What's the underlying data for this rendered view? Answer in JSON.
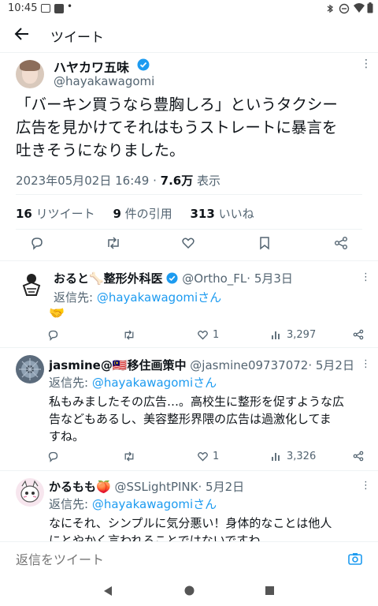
{
  "status_bar": {
    "time": "10:45",
    "dot": "•"
  },
  "header": {
    "title": "ツイート"
  },
  "tweet": {
    "display_name": "ハヤカワ五味",
    "handle": "@hayakawagomi",
    "body_line1": "「バーキン買うなら豊胸しろ」というタクシー",
    "body_line2": "広告を見かけてそれはもうストレートに暴言を",
    "body_line3": "吐きそうになりました。",
    "timestamp": "2023年05月02日 16:49",
    "separator": " · ",
    "views": "7.6万",
    "views_label": "表示",
    "retweets_count": "16",
    "retweets_label": "リツイート",
    "quotes_count": "9",
    "quotes_label": "件の引用",
    "likes_count": "313",
    "likes_label": "いいね"
  },
  "replies": [
    {
      "display_name": "おると🦴整形外科医",
      "handle": "@Ortho_FL",
      "date": "· 5月3日",
      "reply_to_prefix": "返信先: ",
      "reply_to": "@hayakawagomiさん",
      "text": "🤝",
      "likes": "1",
      "views": "3,297"
    },
    {
      "display_name": "jasmine@🇲🇾移住画策中",
      "handle": "@jasmine09737072",
      "date": "· 5月2日",
      "reply_to_prefix": "返信先: ",
      "reply_to": "@hayakawagomiさん",
      "text_line1": "私もみましたその広告…。高校生に整形を促すような広",
      "text_line2": "告などもあるし、美容整形界隈の広告は過激化してま",
      "text_line3": "すね。",
      "likes": "1",
      "views": "3,326"
    },
    {
      "display_name": "かるもも🍑",
      "handle": "@SSLightPINK",
      "date": "· 5月2日",
      "reply_to_prefix": "返信先: ",
      "reply_to": "@hayakawagomiさん",
      "text_line1": "なにそれ、シンプルに気分悪い！身体的なことは他人",
      "text_line2": "にとやかく言われることではないですわ"
    }
  ],
  "composer": {
    "placeholder": "返信をツイート"
  },
  "colors": {
    "accent": "#1d9bf0",
    "verified": "#1d9bf0",
    "text": "#0f1419",
    "muted": "#536471"
  }
}
